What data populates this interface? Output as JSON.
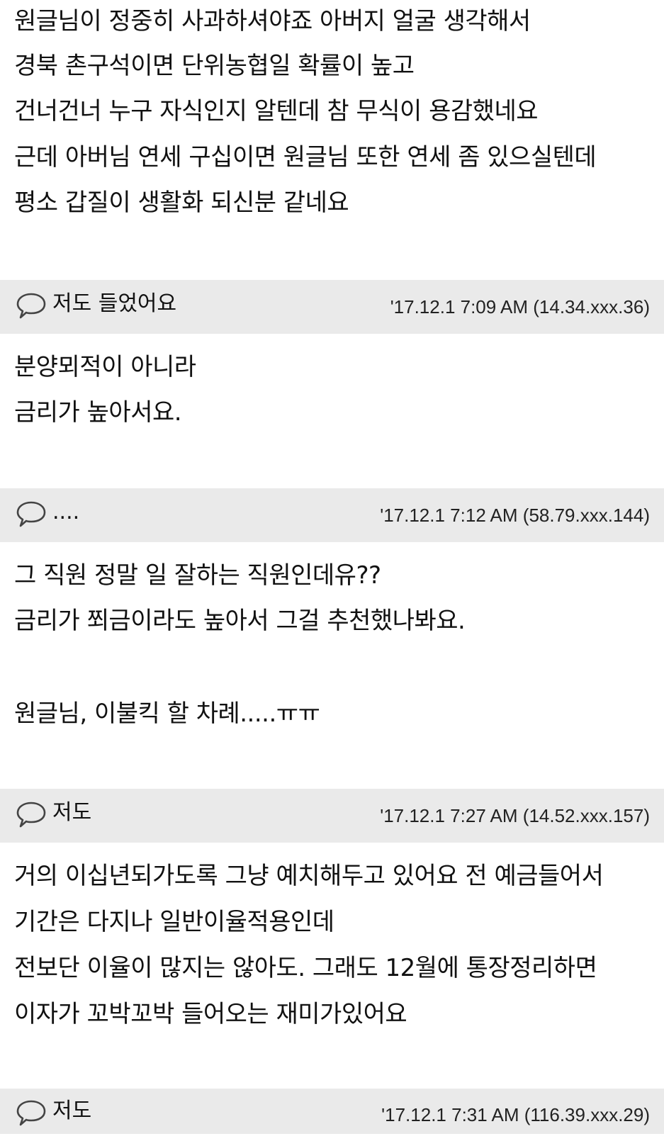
{
  "post_tail": {
    "lines": [
      "원글님이 정중히 사과하셔야죠 아버지 얼굴 생각해서",
      "경북 촌구석이면 단위농협일 확률이 높고",
      "건너건너 누구 자식인지 알텐데 참 무식이 용감했네요",
      "근데 아버님 연세 구십이면 원글님 또한 연세 좀 있으실텐데",
      "평소 갑질이 생활화 되신분 같네요"
    ]
  },
  "comments": [
    {
      "nickname": "저도 들었어요",
      "meta": "'17.12.1 7:09 AM (14.34.xxx.36)",
      "lines": [
        "분양뫼적이 아니라",
        "금리가 높아서요."
      ]
    },
    {
      "nickname": "....",
      "meta": "'17.12.1 7:12 AM (58.79.xxx.144)",
      "lines": [
        "그 직원 정말 일 잘하는 직원인데유??",
        "금리가 쬐금이라도 높아서 그걸 추천했나봐요.",
        "",
        "원글님, 이불킥 할 차례.....ㅠㅠ"
      ]
    },
    {
      "nickname": "저도",
      "meta": "'17.12.1 7:27 AM (14.52.xxx.157)",
      "lines": [
        "거의 이십년되가도록 그냥 예치해두고 있어요 전 예금들어서",
        "기간은 다지나 일반이율적용인데",
        "전보단 이율이 많지는 않아도. 그래도 12월에 통장정리하면",
        "이자가 꼬박꼬박 들어오는 재미가있어요"
      ]
    },
    {
      "nickname": "저도",
      "meta": "'17.12.1 7:31 AM (116.39.xxx.29)",
      "lines": []
    }
  ],
  "colors": {
    "bar_background": "#eaeaea",
    "text": "#111111"
  },
  "icons": {
    "comment": "speech-bubble-icon"
  }
}
